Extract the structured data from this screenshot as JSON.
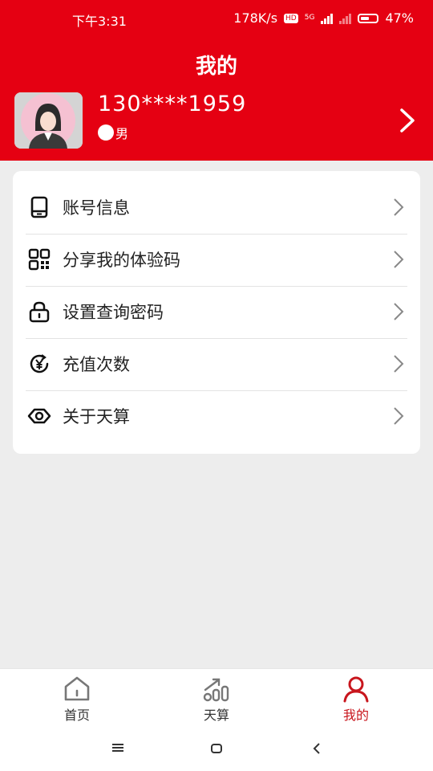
{
  "status": {
    "time": "下午3:31",
    "speed": "178K/s",
    "hd": "HD",
    "net": "5G",
    "battery": "47%"
  },
  "header": {
    "title": "我的"
  },
  "profile": {
    "phone": "130****1959",
    "gender": "男"
  },
  "menu": [
    {
      "label": "账号信息",
      "icon": "tablet-icon"
    },
    {
      "label": "分享我的体验码",
      "icon": "qr-code-icon"
    },
    {
      "label": "设置查询密码",
      "icon": "lock-icon"
    },
    {
      "label": "充值次数",
      "icon": "yen-refresh-icon"
    },
    {
      "label": "关于天算",
      "icon": "eye-icon"
    }
  ],
  "tabs": [
    {
      "label": "首页",
      "icon": "home-icon",
      "active": false
    },
    {
      "label": "天算",
      "icon": "chart-icon",
      "active": false
    },
    {
      "label": "我的",
      "icon": "user-icon",
      "active": true
    }
  ],
  "colors": {
    "brand": "#e50012",
    "active_tab": "#c8161d"
  }
}
